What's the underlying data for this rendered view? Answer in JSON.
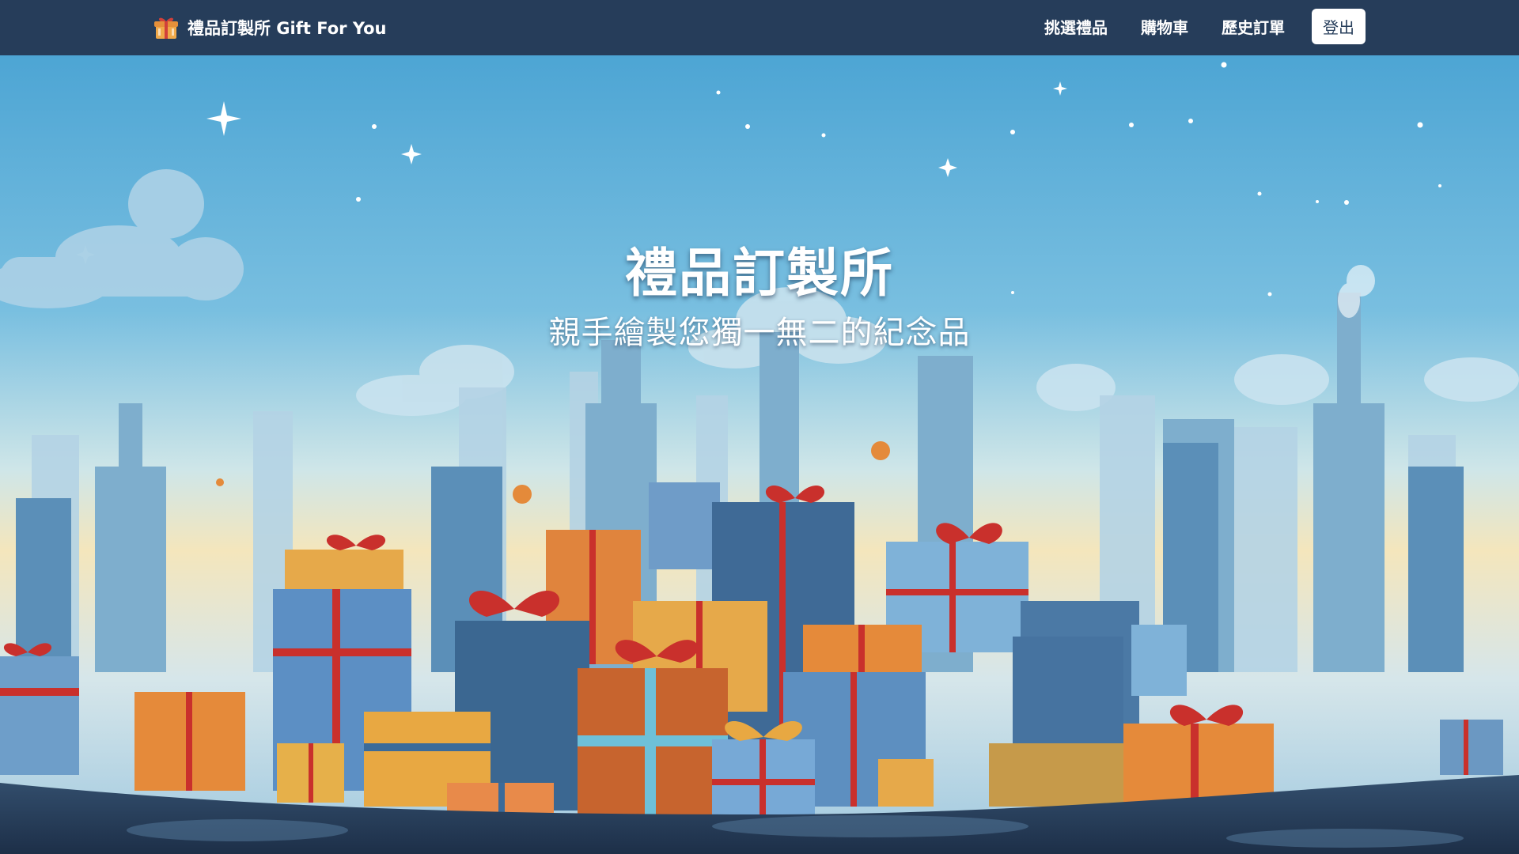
{
  "navbar": {
    "brand_icon": "gift-icon",
    "brand_label": "禮品訂製所 Gift For You",
    "links": [
      {
        "label": "挑選禮品"
      },
      {
        "label": "購物車"
      },
      {
        "label": "歷史訂單"
      }
    ],
    "logout_label": "登出",
    "background_color": "#263d5a"
  },
  "hero": {
    "title": "禮品訂製所",
    "subtitle": "親手繪製您獨一無二的紀念品",
    "illustration": "gift-boxes-city-illustration",
    "colors": {
      "sky_top": "#4fa6d4",
      "sky_horizon": "#f3e3b6",
      "gift_orange": "#e58a3a",
      "gift_blue": "#5f93c2",
      "ribbon_red": "#c9302c"
    }
  }
}
